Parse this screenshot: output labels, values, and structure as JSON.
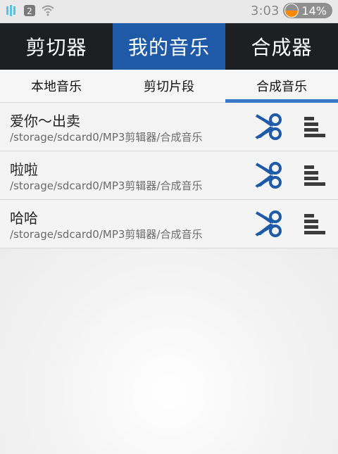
{
  "status_bar": {
    "time": "3:03",
    "battery": "14%",
    "notification_badge": "2"
  },
  "top_tabs": [
    {
      "label": "剪切器",
      "active": false
    },
    {
      "label": "我的音乐",
      "active": true
    },
    {
      "label": "合成器",
      "active": false
    }
  ],
  "sub_tabs": [
    {
      "label": "本地音乐",
      "active": false
    },
    {
      "label": "剪切片段",
      "active": false
    },
    {
      "label": "合成音乐",
      "active": true
    }
  ],
  "items": [
    {
      "title": "爱你～出卖",
      "path": "/storage/sdcard0/MP3剪辑器/合成音乐"
    },
    {
      "title": "啦啦",
      "path": "/storage/sdcard0/MP3剪辑器/合成音乐"
    },
    {
      "title": "哈哈",
      "path": "/storage/sdcard0/MP3剪辑器/合成音乐"
    }
  ],
  "colors": {
    "top_bg": "#1e1f22",
    "top_active": "#1f5aa8",
    "sub_active_indicator": "#3a77c6",
    "scissors_blue": "#1f5aa8",
    "menu_dark": "#3b3b3b"
  },
  "icons": {
    "status_left": [
      "app-icon",
      "notification-badge-icon",
      "wifi-icon"
    ],
    "row_actions": [
      "scissors-icon",
      "menu-icon"
    ]
  }
}
